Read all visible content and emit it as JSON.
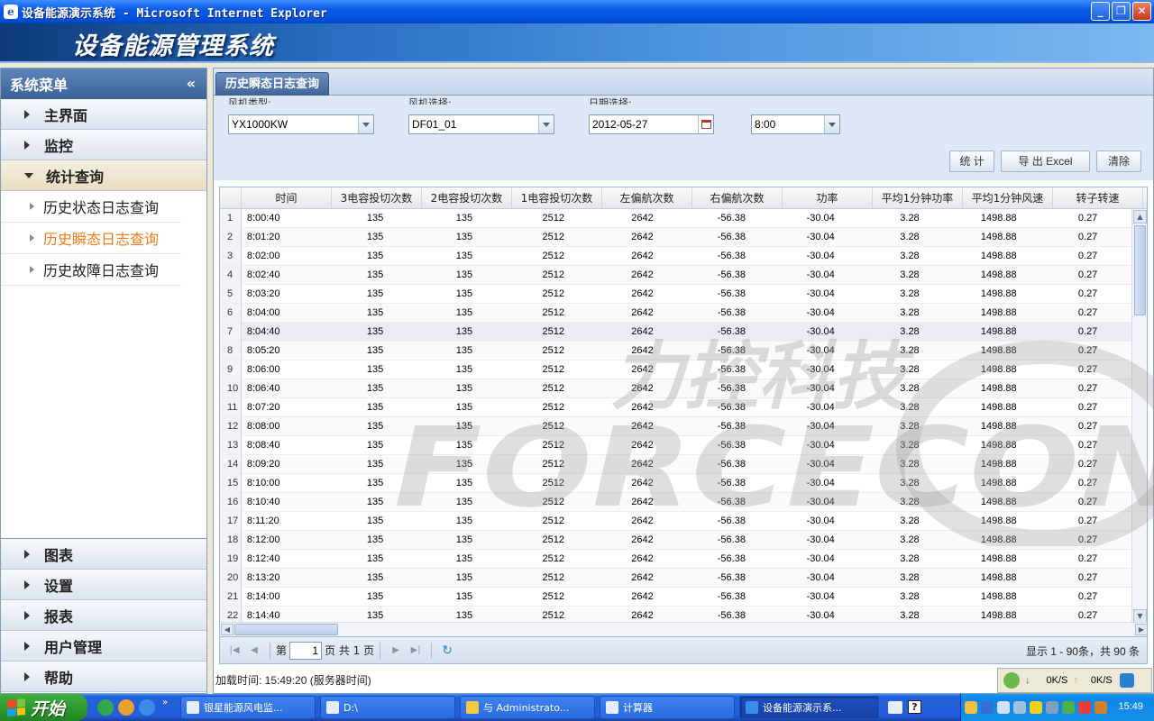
{
  "window": {
    "title": "设备能源演示系统 - Microsoft Internet Explorer"
  },
  "app": {
    "title": "设备能源管理系统"
  },
  "sidebar": {
    "header": "系统菜单",
    "collapse": "«",
    "top_menus": [
      {
        "label": "主界面"
      },
      {
        "label": "监控"
      },
      {
        "label": "统计查询"
      }
    ],
    "sub_items": [
      {
        "label": "历史状态日志查询"
      },
      {
        "label": "历史瞬态日志查询"
      },
      {
        "label": "历史故障日志查询"
      }
    ],
    "bottom_menus": [
      {
        "label": "图表"
      },
      {
        "label": "设置"
      },
      {
        "label": "报表"
      },
      {
        "label": "用户管理"
      },
      {
        "label": "帮助"
      }
    ]
  },
  "tab": {
    "label": "历史瞬态日志查询"
  },
  "filters": {
    "type_label": "风机类型:",
    "type_value": "YX1000KW",
    "turbine_label": "风机选择:",
    "turbine_value": "DF01_01",
    "date_label": "日期选择:",
    "date_value": "2012-05-27",
    "time_value": "8:00"
  },
  "buttons": {
    "stat": "统 计",
    "export": "导 出 Excel",
    "clear": "清除"
  },
  "grid": {
    "columns": [
      "时间",
      "3电容投切次数",
      "2电容投切次数",
      "1电容投切次数",
      "左偏航次数",
      "右偏航次数",
      "功率",
      "平均1分钟功率",
      "平均1分钟风速",
      "转子转速"
    ],
    "rows": [
      [
        "1",
        "8:00:40",
        "135",
        "135",
        "2512",
        "2642",
        "-56.38",
        "-30.04",
        "3.28",
        "1498.88",
        "0.27"
      ],
      [
        "2",
        "8:01:20",
        "135",
        "135",
        "2512",
        "2642",
        "-56.38",
        "-30.04",
        "3.28",
        "1498.88",
        "0.27"
      ],
      [
        "3",
        "8:02:00",
        "135",
        "135",
        "2512",
        "2642",
        "-56.38",
        "-30.04",
        "3.28",
        "1498.88",
        "0.27"
      ],
      [
        "4",
        "8:02:40",
        "135",
        "135",
        "2512",
        "2642",
        "-56.38",
        "-30.04",
        "3.28",
        "1498.88",
        "0.27"
      ],
      [
        "5",
        "8:03:20",
        "135",
        "135",
        "2512",
        "2642",
        "-56.38",
        "-30.04",
        "3.28",
        "1498.88",
        "0.27"
      ],
      [
        "6",
        "8:04:00",
        "135",
        "135",
        "2512",
        "2642",
        "-56.38",
        "-30.04",
        "3.28",
        "1498.88",
        "0.27"
      ],
      [
        "7",
        "8:04:40",
        "135",
        "135",
        "2512",
        "2642",
        "-56.38",
        "-30.04",
        "3.28",
        "1498.88",
        "0.27"
      ],
      [
        "8",
        "8:05:20",
        "135",
        "135",
        "2512",
        "2642",
        "-56.38",
        "-30.04",
        "3.28",
        "1498.88",
        "0.27"
      ],
      [
        "9",
        "8:06:00",
        "135",
        "135",
        "2512",
        "2642",
        "-56.38",
        "-30.04",
        "3.28",
        "1498.88",
        "0.27"
      ],
      [
        "10",
        "8:06:40",
        "135",
        "135",
        "2512",
        "2642",
        "-56.38",
        "-30.04",
        "3.28",
        "1498.88",
        "0.27"
      ],
      [
        "11",
        "8:07:20",
        "135",
        "135",
        "2512",
        "2642",
        "-56.38",
        "-30.04",
        "3.28",
        "1498.88",
        "0.27"
      ],
      [
        "12",
        "8:08:00",
        "135",
        "135",
        "2512",
        "2642",
        "-56.38",
        "-30.04",
        "3.28",
        "1498.88",
        "0.27"
      ],
      [
        "13",
        "8:08:40",
        "135",
        "135",
        "2512",
        "2642",
        "-56.38",
        "-30.04",
        "3.28",
        "1498.88",
        "0.27"
      ],
      [
        "14",
        "8:09:20",
        "135",
        "135",
        "2512",
        "2642",
        "-56.38",
        "-30.04",
        "3.28",
        "1498.88",
        "0.27"
      ],
      [
        "15",
        "8:10:00",
        "135",
        "135",
        "2512",
        "2642",
        "-56.38",
        "-30.04",
        "3.28",
        "1498.88",
        "0.27"
      ],
      [
        "16",
        "8:10:40",
        "135",
        "135",
        "2512",
        "2642",
        "-56.38",
        "-30.04",
        "3.28",
        "1498.88",
        "0.27"
      ],
      [
        "17",
        "8:11:20",
        "135",
        "135",
        "2512",
        "2642",
        "-56.38",
        "-30.04",
        "3.28",
        "1498.88",
        "0.27"
      ],
      [
        "18",
        "8:12:00",
        "135",
        "135",
        "2512",
        "2642",
        "-56.38",
        "-30.04",
        "3.28",
        "1498.88",
        "0.27"
      ],
      [
        "19",
        "8:12:40",
        "135",
        "135",
        "2512",
        "2642",
        "-56.38",
        "-30.04",
        "3.28",
        "1498.88",
        "0.27"
      ],
      [
        "20",
        "8:13:20",
        "135",
        "135",
        "2512",
        "2642",
        "-56.38",
        "-30.04",
        "3.28",
        "1498.88",
        "0.27"
      ],
      [
        "21",
        "8:14:00",
        "135",
        "135",
        "2512",
        "2642",
        "-56.38",
        "-30.04",
        "3.28",
        "1498.88",
        "0.27"
      ],
      [
        "22",
        "8:14:40",
        "135",
        "135",
        "2512",
        "2642",
        "-56.38",
        "-30.04",
        "3.28",
        "1498.88",
        "0.27"
      ]
    ]
  },
  "pager": {
    "page_prefix": "第",
    "page_value": "1",
    "page_suffix": "页 共 1 页",
    "info": "显示 1 - 90条，共 90 条"
  },
  "status": {
    "load_time": "加载时间: 15:49:20 (服务器时间)",
    "down_rate": "0K/S",
    "up_rate": "0K/S"
  },
  "watermark": {
    "cn": "力控科技",
    "en": "FORCECON"
  },
  "taskbar": {
    "start": "开始",
    "tasks": [
      {
        "label": "银星能源风电监..."
      },
      {
        "label": "D:\\"
      },
      {
        "label": "与 Administrato..."
      },
      {
        "label": "计算器"
      },
      {
        "label": "设备能源演示系..."
      }
    ],
    "clock": "15:49"
  },
  "colors": {
    "accent": "#EE7B1F",
    "header_blue": "#3C6399",
    "title_blue": "#0A5CE8"
  }
}
